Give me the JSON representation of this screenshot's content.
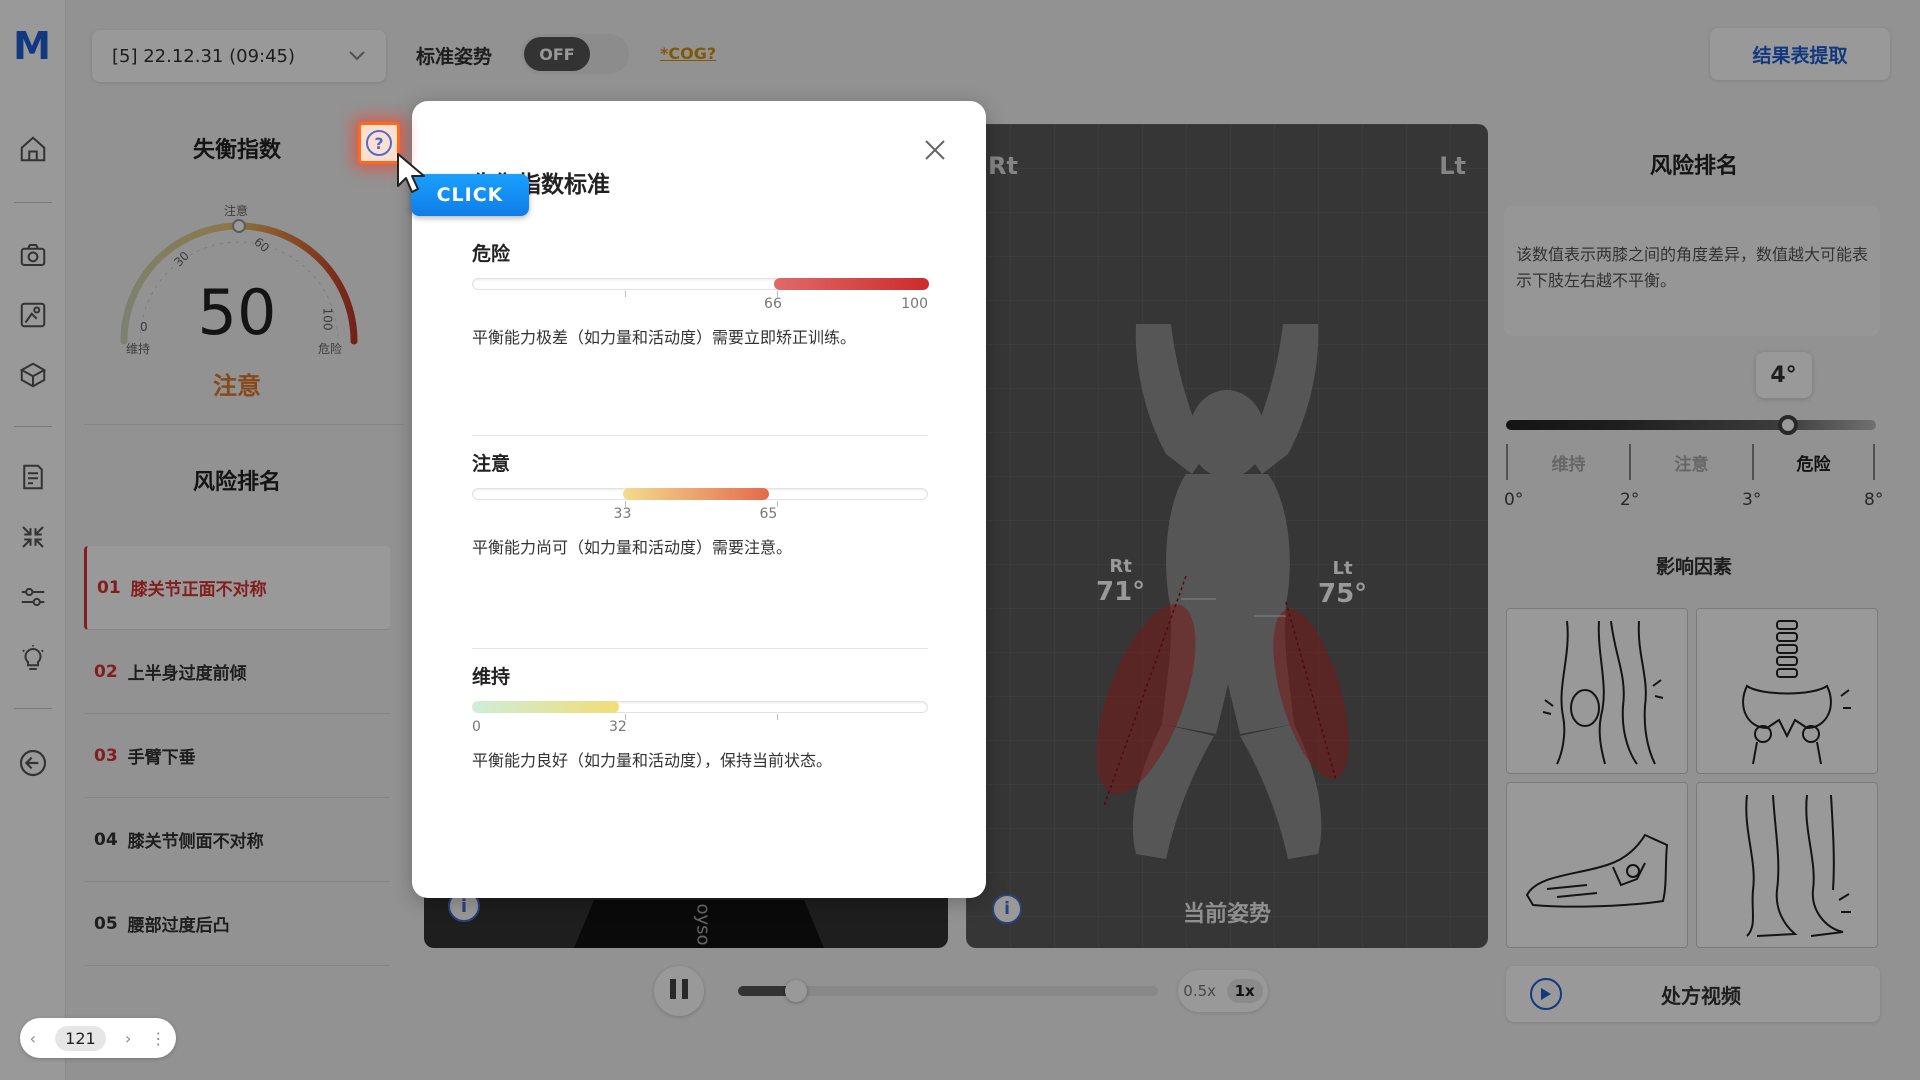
{
  "app": {
    "logo": "M"
  },
  "topbar": {
    "session_date": "[5] 22.12.31 (09:45)",
    "standard_pose_label": "标准姿势",
    "toggle_state": "OFF",
    "cog_link": "*COG?",
    "result_button": "结果表提取"
  },
  "imbalance": {
    "title": "失衡指数",
    "value": "50",
    "status": "注意",
    "gauge_labels": {
      "caution": "注意",
      "maintain": "维持",
      "danger": "危险",
      "t30": "30",
      "t60": "60",
      "t0": "0",
      "t100": "100"
    }
  },
  "risk_ranking": {
    "title": "风险排名",
    "items": [
      {
        "num": "01",
        "label": "膝关节正面不对称"
      },
      {
        "num": "02",
        "label": "上半身过度前倾"
      },
      {
        "num": "03",
        "label": "手臂下垂"
      },
      {
        "num": "04",
        "label": "膝关节侧面不对称"
      },
      {
        "num": "05",
        "label": "腰部过度后凸"
      }
    ]
  },
  "posture": {
    "rt": "Rt",
    "lt": "Lt",
    "rt_angle_label": "Rt",
    "rt_angle": "71°",
    "lt_angle_label": "Lt",
    "lt_angle": "75°",
    "caption": "当前姿势",
    "video_text": "oyso"
  },
  "player": {
    "speed_slow": "0.5x",
    "speed_normal": "1x",
    "progress": 0.13
  },
  "right": {
    "title": "风险排名",
    "description": "该数值表示两膝之间的角度差异，数值越大可能表示下肢左右越不平衡。",
    "value": "4°",
    "value_fraction": 0.75,
    "categories": [
      "维持",
      "注意",
      "危险"
    ],
    "ticks": [
      "0°",
      "2°",
      "3°",
      "8°"
    ],
    "factors_title": "影响因素",
    "prescription_video": "处方视频"
  },
  "pager": {
    "page": "121"
  },
  "modal": {
    "title": "失衡指数标准",
    "levels": [
      {
        "name": "危险",
        "range": [
          66,
          100
        ],
        "ticks": [
          "66",
          "100"
        ],
        "desc": "平衡能力极差（如力量和活动度）需要立即矫正训练。",
        "color_start": "#e06a6a",
        "color_end": "#cc2b2b"
      },
      {
        "name": "注意",
        "range": [
          33,
          65
        ],
        "ticks": [
          "33",
          "65"
        ],
        "desc": "平衡能力尚可（如力量和活动度）需要注意。",
        "color_start": "#f3dc8e",
        "color_end": "#e46a4c"
      },
      {
        "name": "维持",
        "range": [
          0,
          32
        ],
        "ticks": [
          "0",
          "32"
        ],
        "desc": "平衡能力良好（如力量和活动度），保持当前状态。",
        "color_start": "#cdeed8",
        "color_end": "#f2dc76"
      }
    ]
  },
  "tutorial": {
    "click_badge": "CLICK"
  }
}
